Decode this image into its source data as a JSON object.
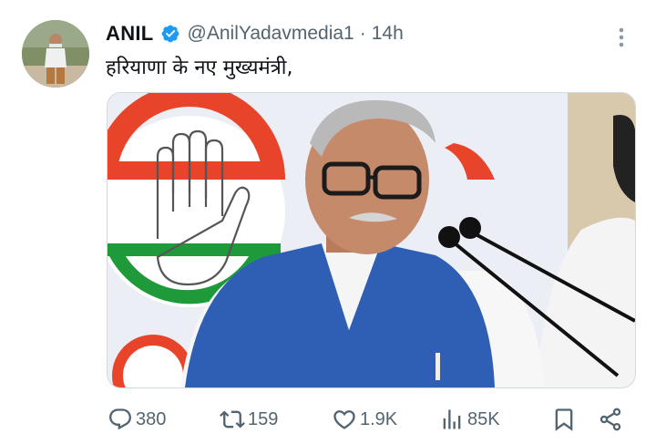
{
  "tweet": {
    "author_name": "ANIL",
    "verified": true,
    "handle": "@AnilYadavmedia1",
    "separator": "·",
    "time": "14h",
    "text": "हरियाणा के नए मुख्यमंत्री,"
  },
  "actions": {
    "replies": "380",
    "retweets": "159",
    "likes": "1.9K",
    "views": "85K"
  },
  "icons": {
    "verified": "verified-badge-icon",
    "more": "more-vertical-icon",
    "reply": "reply-icon",
    "retweet": "retweet-icon",
    "like": "heart-icon",
    "views": "views-bar-chart-icon",
    "bookmark": "bookmark-icon",
    "share": "share-icon"
  },
  "colors": {
    "text_primary": "#0f1419",
    "text_secondary": "#536471",
    "verified_blue": "#1d9bf0",
    "vest_blue": "#2f5fb4",
    "congress_orange": "#e8442a",
    "congress_green": "#1e9a3b"
  }
}
